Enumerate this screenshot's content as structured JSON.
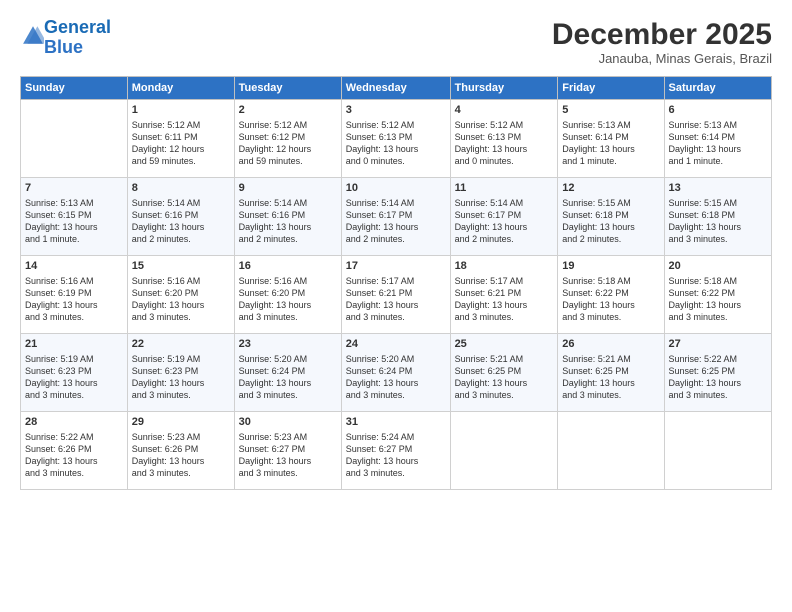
{
  "header": {
    "logo_line1": "General",
    "logo_line2": "Blue",
    "month": "December 2025",
    "location": "Janauba, Minas Gerais, Brazil"
  },
  "days_of_week": [
    "Sunday",
    "Monday",
    "Tuesday",
    "Wednesday",
    "Thursday",
    "Friday",
    "Saturday"
  ],
  "weeks": [
    [
      {
        "day": "",
        "info": ""
      },
      {
        "day": "1",
        "info": "Sunrise: 5:12 AM\nSunset: 6:11 PM\nDaylight: 12 hours\nand 59 minutes."
      },
      {
        "day": "2",
        "info": "Sunrise: 5:12 AM\nSunset: 6:12 PM\nDaylight: 12 hours\nand 59 minutes."
      },
      {
        "day": "3",
        "info": "Sunrise: 5:12 AM\nSunset: 6:13 PM\nDaylight: 13 hours\nand 0 minutes."
      },
      {
        "day": "4",
        "info": "Sunrise: 5:12 AM\nSunset: 6:13 PM\nDaylight: 13 hours\nand 0 minutes."
      },
      {
        "day": "5",
        "info": "Sunrise: 5:13 AM\nSunset: 6:14 PM\nDaylight: 13 hours\nand 1 minute."
      },
      {
        "day": "6",
        "info": "Sunrise: 5:13 AM\nSunset: 6:14 PM\nDaylight: 13 hours\nand 1 minute."
      }
    ],
    [
      {
        "day": "7",
        "info": "Sunrise: 5:13 AM\nSunset: 6:15 PM\nDaylight: 13 hours\nand 1 minute."
      },
      {
        "day": "8",
        "info": "Sunrise: 5:14 AM\nSunset: 6:16 PM\nDaylight: 13 hours\nand 2 minutes."
      },
      {
        "day": "9",
        "info": "Sunrise: 5:14 AM\nSunset: 6:16 PM\nDaylight: 13 hours\nand 2 minutes."
      },
      {
        "day": "10",
        "info": "Sunrise: 5:14 AM\nSunset: 6:17 PM\nDaylight: 13 hours\nand 2 minutes."
      },
      {
        "day": "11",
        "info": "Sunrise: 5:14 AM\nSunset: 6:17 PM\nDaylight: 13 hours\nand 2 minutes."
      },
      {
        "day": "12",
        "info": "Sunrise: 5:15 AM\nSunset: 6:18 PM\nDaylight: 13 hours\nand 2 minutes."
      },
      {
        "day": "13",
        "info": "Sunrise: 5:15 AM\nSunset: 6:18 PM\nDaylight: 13 hours\nand 3 minutes."
      }
    ],
    [
      {
        "day": "14",
        "info": "Sunrise: 5:16 AM\nSunset: 6:19 PM\nDaylight: 13 hours\nand 3 minutes."
      },
      {
        "day": "15",
        "info": "Sunrise: 5:16 AM\nSunset: 6:20 PM\nDaylight: 13 hours\nand 3 minutes."
      },
      {
        "day": "16",
        "info": "Sunrise: 5:16 AM\nSunset: 6:20 PM\nDaylight: 13 hours\nand 3 minutes."
      },
      {
        "day": "17",
        "info": "Sunrise: 5:17 AM\nSunset: 6:21 PM\nDaylight: 13 hours\nand 3 minutes."
      },
      {
        "day": "18",
        "info": "Sunrise: 5:17 AM\nSunset: 6:21 PM\nDaylight: 13 hours\nand 3 minutes."
      },
      {
        "day": "19",
        "info": "Sunrise: 5:18 AM\nSunset: 6:22 PM\nDaylight: 13 hours\nand 3 minutes."
      },
      {
        "day": "20",
        "info": "Sunrise: 5:18 AM\nSunset: 6:22 PM\nDaylight: 13 hours\nand 3 minutes."
      }
    ],
    [
      {
        "day": "21",
        "info": "Sunrise: 5:19 AM\nSunset: 6:23 PM\nDaylight: 13 hours\nand 3 minutes."
      },
      {
        "day": "22",
        "info": "Sunrise: 5:19 AM\nSunset: 6:23 PM\nDaylight: 13 hours\nand 3 minutes."
      },
      {
        "day": "23",
        "info": "Sunrise: 5:20 AM\nSunset: 6:24 PM\nDaylight: 13 hours\nand 3 minutes."
      },
      {
        "day": "24",
        "info": "Sunrise: 5:20 AM\nSunset: 6:24 PM\nDaylight: 13 hours\nand 3 minutes."
      },
      {
        "day": "25",
        "info": "Sunrise: 5:21 AM\nSunset: 6:25 PM\nDaylight: 13 hours\nand 3 minutes."
      },
      {
        "day": "26",
        "info": "Sunrise: 5:21 AM\nSunset: 6:25 PM\nDaylight: 13 hours\nand 3 minutes."
      },
      {
        "day": "27",
        "info": "Sunrise: 5:22 AM\nSunset: 6:25 PM\nDaylight: 13 hours\nand 3 minutes."
      }
    ],
    [
      {
        "day": "28",
        "info": "Sunrise: 5:22 AM\nSunset: 6:26 PM\nDaylight: 13 hours\nand 3 minutes."
      },
      {
        "day": "29",
        "info": "Sunrise: 5:23 AM\nSunset: 6:26 PM\nDaylight: 13 hours\nand 3 minutes."
      },
      {
        "day": "30",
        "info": "Sunrise: 5:23 AM\nSunset: 6:27 PM\nDaylight: 13 hours\nand 3 minutes."
      },
      {
        "day": "31",
        "info": "Sunrise: 5:24 AM\nSunset: 6:27 PM\nDaylight: 13 hours\nand 3 minutes."
      },
      {
        "day": "",
        "info": ""
      },
      {
        "day": "",
        "info": ""
      },
      {
        "day": "",
        "info": ""
      }
    ]
  ]
}
